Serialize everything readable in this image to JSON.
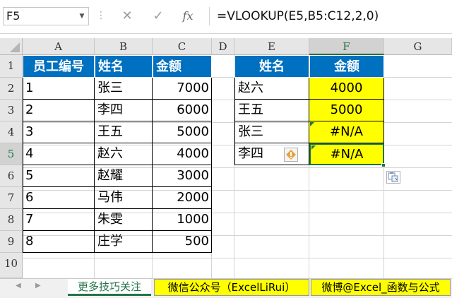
{
  "formula_bar": {
    "name_box": "F5",
    "cancel_glyph": "✕",
    "enter_glyph": "✓",
    "fx_glyph": "fx",
    "formula": "=VLOOKUP(E5,B5:C12,2,0)"
  },
  "columns": [
    "A",
    "B",
    "C",
    "D",
    "E",
    "F",
    "G"
  ],
  "rows": [
    "1",
    "2",
    "3",
    "4",
    "5",
    "6",
    "7",
    "8",
    "9",
    "10"
  ],
  "selected_cell": "F5",
  "source_table": {
    "headers": [
      "员工编号",
      "姓名",
      "金额"
    ],
    "rows": [
      [
        "1",
        "张三",
        "7000"
      ],
      [
        "2",
        "李四",
        "6000"
      ],
      [
        "3",
        "王五",
        "5000"
      ],
      [
        "4",
        "赵六",
        "4000"
      ],
      [
        "5",
        "赵耀",
        "3000"
      ],
      [
        "6",
        "马伟",
        "2000"
      ],
      [
        "7",
        "朱雯",
        "1000"
      ],
      [
        "8",
        "庄学",
        "500"
      ]
    ]
  },
  "lookup_table": {
    "headers": [
      "姓名",
      "金额"
    ],
    "rows": [
      [
        "赵六",
        "4000"
      ],
      [
        "王五",
        "5000"
      ],
      [
        "张三",
        "#N/A"
      ],
      [
        "李四",
        "#N/A"
      ]
    ]
  },
  "sheet_tabs": [
    "更多技巧关注",
    "微信公众号（ExcelLiRui）",
    "微博@Excel_函数与公式"
  ],
  "colors": {
    "header_fill": "#0070c0",
    "highlight_fill": "#ffff00",
    "excel_green": "#217346"
  },
  "icons": [
    "dropdown-arrow-icon",
    "cancel-icon",
    "enter-icon",
    "function-icon",
    "error-warning-icon",
    "paste-options-icon",
    "sheet-nav-left-icon",
    "sheet-nav-right-icon"
  ]
}
